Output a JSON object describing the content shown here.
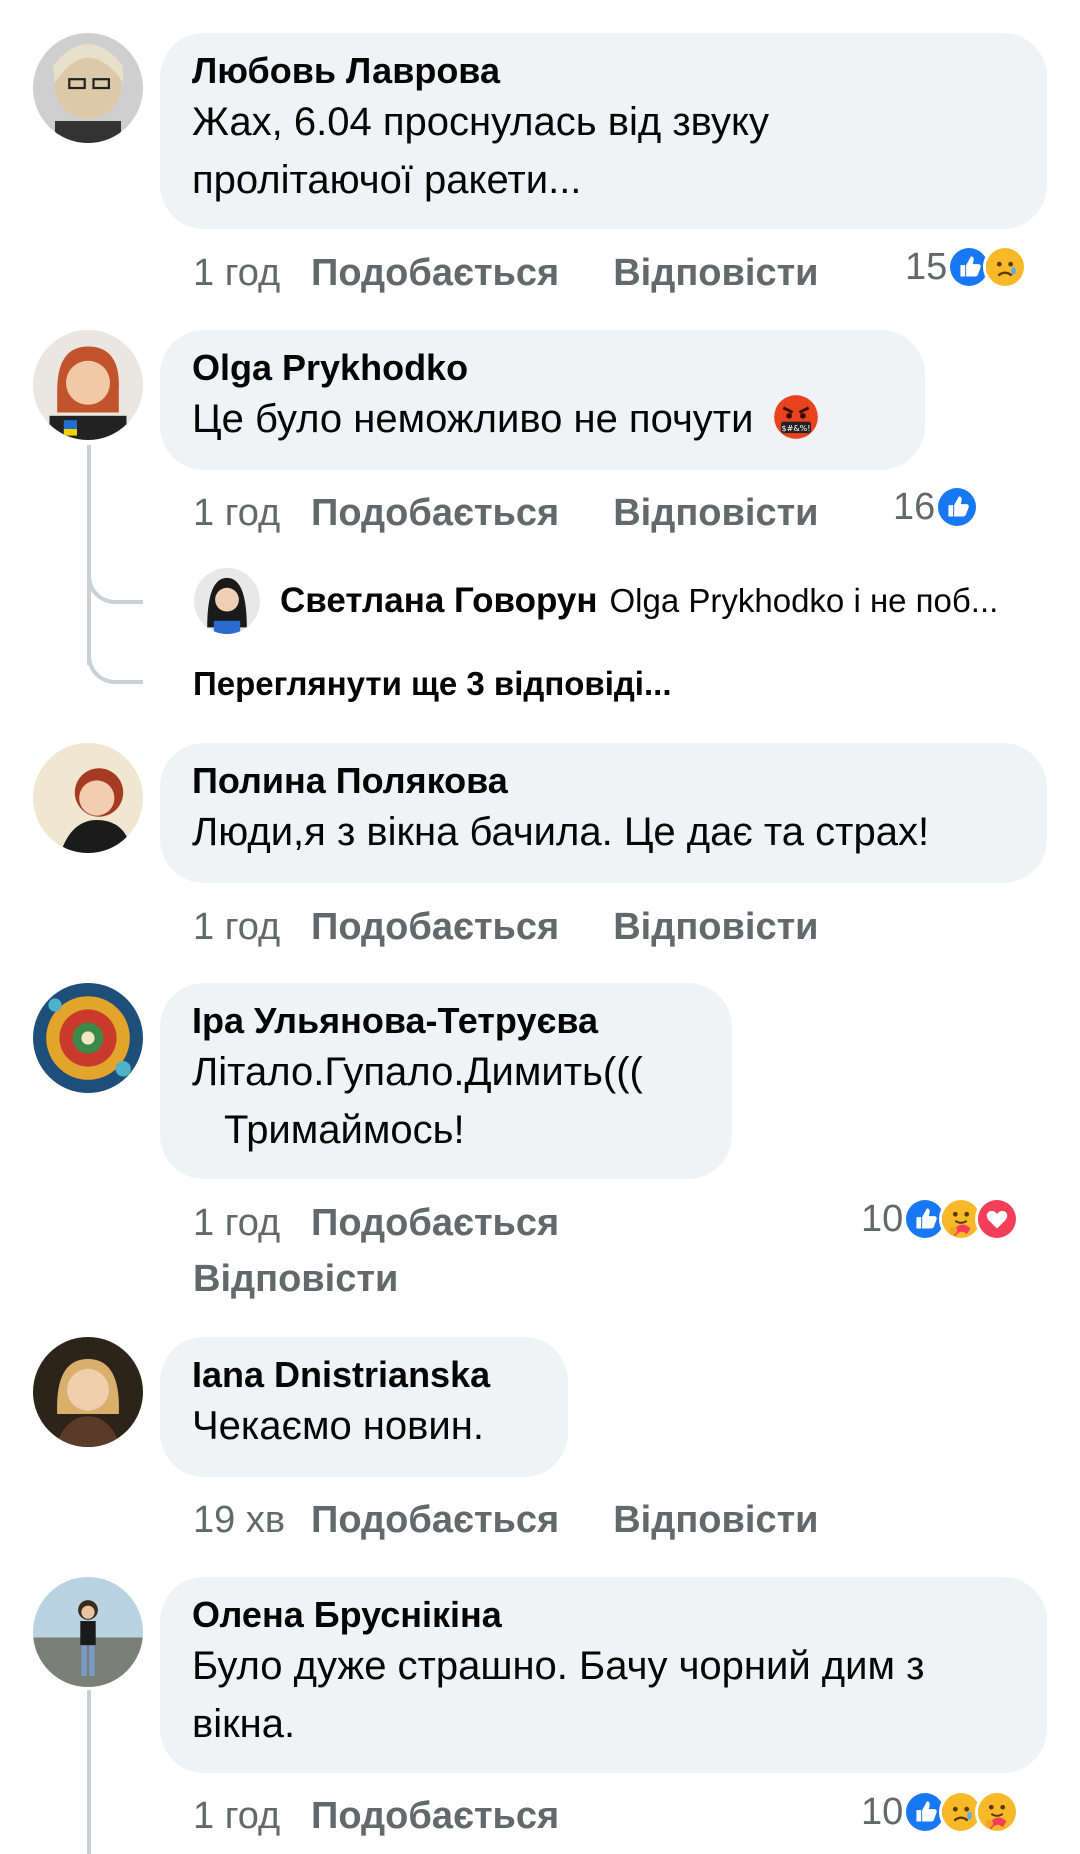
{
  "comments": [
    {
      "author": "Любовь Лаврова",
      "text_lines": [
        "Жах, 6.04 проснулась від звуку",
        "пролітаючої ракети..."
      ],
      "time": "1 год",
      "like_label": "Подобається",
      "reply_label": "Відповісти",
      "reaction_count": "15",
      "reactions": [
        "like",
        "sad"
      ]
    },
    {
      "author": "Olga Prykhodko",
      "text_lines": [
        "Це було неможливо не почути"
      ],
      "emoji": "cursing-face",
      "time": "1 год",
      "like_label": "Подобається",
      "reply_label": "Відповісти",
      "reaction_count": "16",
      "reactions": [
        "like"
      ],
      "reply_preview": {
        "author": "Светлана Говорун",
        "text": "Olga Prykhodko і не поб..."
      },
      "more_replies": "Переглянути ще 3 відповіді..."
    },
    {
      "author": "Полина Полякова",
      "text_lines": [
        "Люди,я з вікна бачила. Це дає та страх!"
      ],
      "time": "1 год",
      "like_label": "Подобається",
      "reply_label": "Відповісти"
    },
    {
      "author": "Іра Ульянова-Тетруєва",
      "text_lines": [
        "Літало.Гупало.Димить(((",
        "Тримаймось!"
      ],
      "time": "1 год",
      "like_label": "Подобається",
      "reply_label": "Відповісти",
      "reaction_count": "10",
      "reactions": [
        "like",
        "care",
        "love"
      ]
    },
    {
      "author": "Iana Dnistrianska",
      "text_lines": [
        "Чекаємо новин."
      ],
      "time": "19 хв",
      "like_label": "Подобається",
      "reply_label": "Відповісти"
    },
    {
      "author": "Олена Бруснікіна",
      "text_lines": [
        "Було дуже страшно. Бачу чорний дим з",
        "вікна."
      ],
      "time": "1 год",
      "like_label": "Подобається",
      "reaction_count": "10",
      "reactions": [
        "like",
        "sad",
        "care"
      ]
    }
  ],
  "colors": {
    "bubble_bg": "#f0f2f5",
    "meta_text": "#65676b",
    "like_blue": "#1877f2",
    "love_red": "#f33e58",
    "emoji_yellow": "#f7b928"
  }
}
